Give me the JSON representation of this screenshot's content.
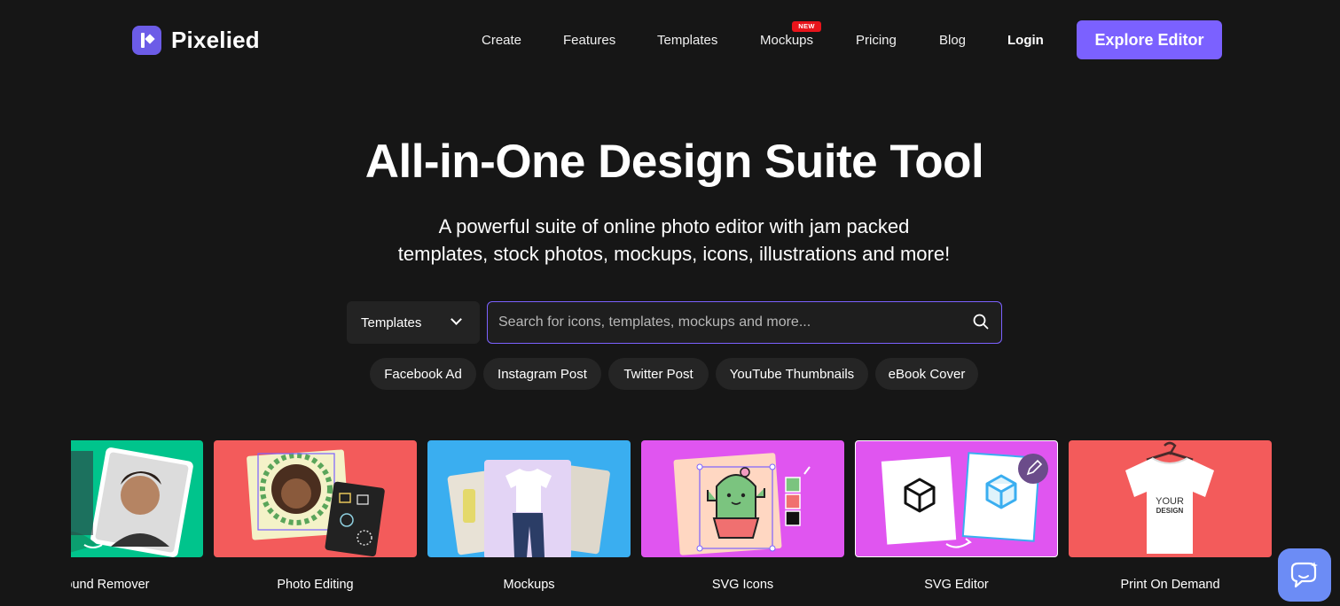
{
  "brand": {
    "name": "Pixelied"
  },
  "nav": {
    "items": [
      "Create",
      "Features",
      "Templates",
      "Mockups",
      "Pricing",
      "Blog"
    ],
    "badge": "NEW",
    "login": "Login",
    "cta": "Explore Editor"
  },
  "hero": {
    "title": "All-in-One Design Suite Tool",
    "subtitle_line1": "A powerful suite of online photo editor with jam packed",
    "subtitle_line2": "templates, stock photos, mockups, icons, illustrations and more!"
  },
  "search": {
    "selected_type": "Templates",
    "placeholder": "Search for icons, templates, mockups and more..."
  },
  "chips": [
    "Facebook Ad",
    "Instagram Post",
    "Twitter Post",
    "YouTube Thumbnails",
    "eBook Cover"
  ],
  "cards": [
    {
      "label": "ground Remover",
      "color": "#00c48c"
    },
    {
      "label": "Photo Editing",
      "color": "#f35b5b"
    },
    {
      "label": "Mockups",
      "color": "#3aaef0"
    },
    {
      "label": "SVG Icons",
      "color": "#e055f0"
    },
    {
      "label": "SVG Editor",
      "color": "#e055f0"
    },
    {
      "label": "Print On Demand",
      "color": "#f35b5b"
    }
  ],
  "colors": {
    "accent": "#7b61ff",
    "background": "#161616",
    "badge": "#e8141b"
  },
  "icons": {
    "search": "search-icon",
    "chevron": "chevron-down-icon",
    "chat": "chat-icon",
    "edit": "pencil-icon"
  }
}
